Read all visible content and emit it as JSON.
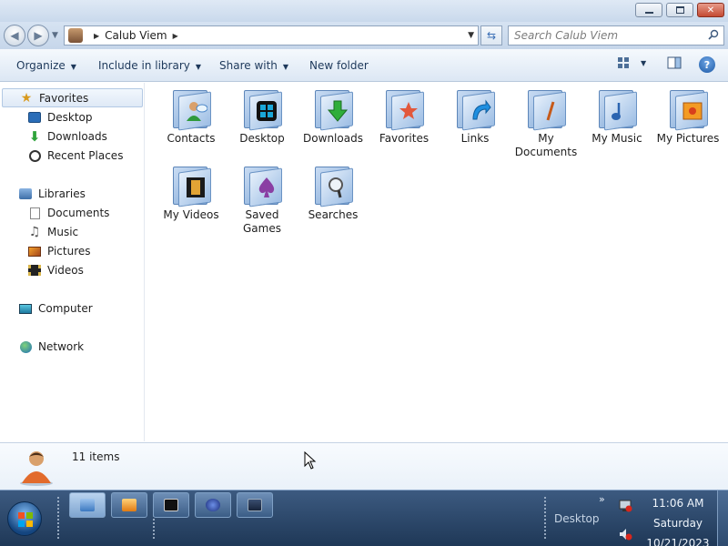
{
  "window": {
    "minimize_icon": "minimize-icon",
    "restore_icon": "restore-icon",
    "close_icon": "close-icon"
  },
  "address": {
    "path": "Calub Viem",
    "search_placeholder": "Search Calub Viem"
  },
  "toolbar": {
    "organize": "Organize",
    "include_in_library": "Include in library",
    "share_with": "Share with",
    "new_folder": "New folder"
  },
  "navpane": {
    "favorites": "Favorites",
    "desktop": "Desktop",
    "downloads": "Downloads",
    "recent_places": "Recent Places",
    "libraries": "Libraries",
    "documents": "Documents",
    "music": "Music",
    "pictures": "Pictures",
    "videos": "Videos",
    "computer": "Computer",
    "network": "Network"
  },
  "files": {
    "contacts": "Contacts",
    "desktop": "Desktop",
    "downloads": "Downloads",
    "favorites": "Favorites",
    "links": "Links",
    "my_documents_1": "My",
    "my_documents_2": "Documents",
    "my_music": "My Music",
    "my_pictures": "My Pictures",
    "my_videos": "My Videos",
    "saved_games_1": "Saved",
    "saved_games_2": "Games",
    "searches": "Searches"
  },
  "details": {
    "item_count": "11 items"
  },
  "taskbar": {
    "tray_desktop": "Desktop",
    "time": "11:06 AM",
    "day": "Saturday",
    "date": "10/21/2023"
  },
  "colors": {
    "window_frame": "#c9d9ec",
    "taskbar": "#2a4668",
    "accent": "#1e395b"
  }
}
